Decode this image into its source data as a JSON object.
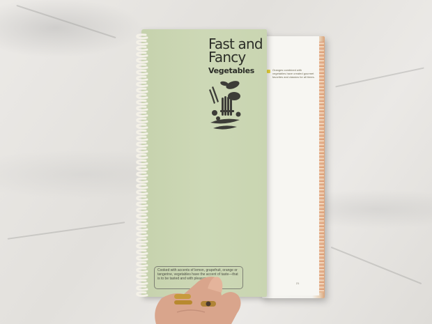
{
  "book": {
    "title_line1": "Fast and",
    "title_line2": "Fancy",
    "subtitle": "Vegetables",
    "intro_text": "Cooked with accents of lemon, grapefruit, orange or tangerine, vegetables have the accent of taste—that is to be tasted and with pleasure.",
    "caption_text": "Oranges combined with vegetables have created gourmet favorites and classics for all times.",
    "page_number": "21"
  },
  "colors": {
    "cover_green": "#c9d5b1",
    "caption_bullet": "#e8d23a",
    "title_ink": "#2c2e28",
    "marble": "#e6e4e0"
  },
  "icons": [
    "vegetable-illustration",
    "spiral-binding"
  ]
}
